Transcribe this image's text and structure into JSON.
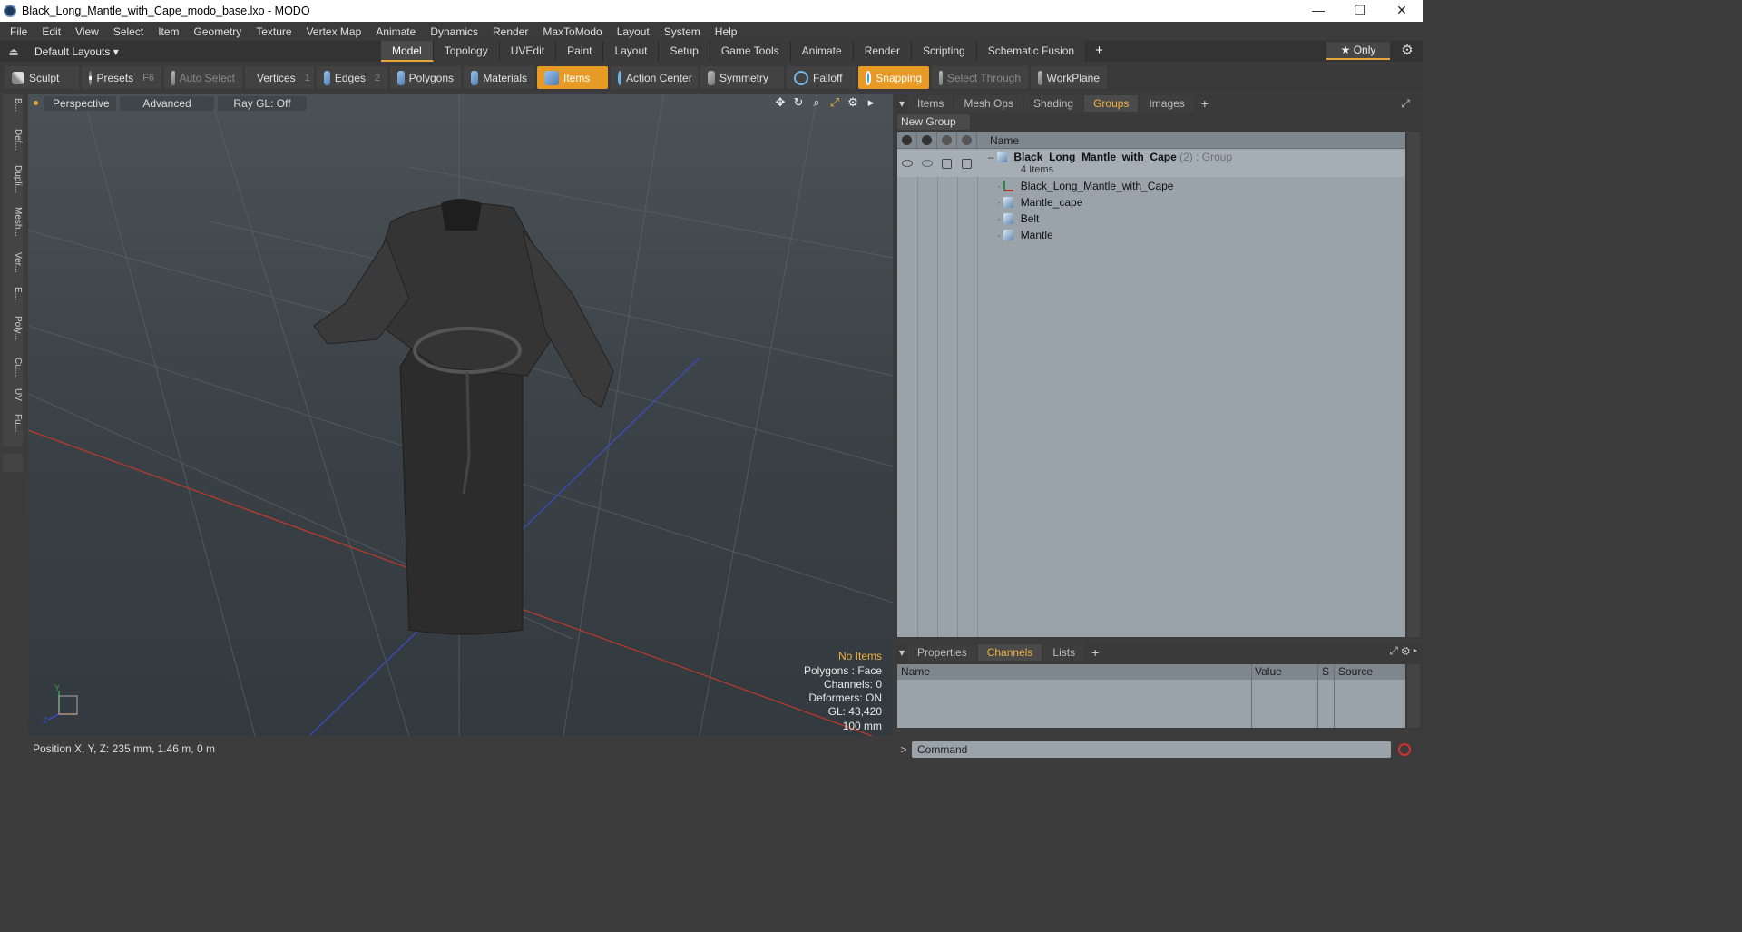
{
  "window": {
    "title": "Black_Long_Mantle_with_Cape_modo_base.lxo - MODO",
    "minimize": "—",
    "restore": "❐",
    "close": "✕"
  },
  "menu": [
    "File",
    "Edit",
    "View",
    "Select",
    "Item",
    "Geometry",
    "Texture",
    "Vertex Map",
    "Animate",
    "Dynamics",
    "Render",
    "MaxToModo",
    "Layout",
    "System",
    "Help"
  ],
  "layout_row": {
    "layouts": "Default Layouts ▾",
    "tabs": [
      "Model",
      "Topology",
      "UVEdit",
      "Paint",
      "Layout",
      "Setup",
      "Game Tools",
      "Animate",
      "Render",
      "Scripting",
      "Schematic Fusion"
    ],
    "active_tab": "Model",
    "add": "+",
    "only": "★  Only"
  },
  "toolbar": {
    "sculpt": "Sculpt",
    "presets": "Presets",
    "presets_key": "F6",
    "auto_select": "Auto Select",
    "vertices": "Vertices",
    "vertices_count": "1",
    "edges": "Edges",
    "edges_count": "2",
    "polygons": "Polygons",
    "materials": "Materials",
    "items": "Items",
    "action_center": "Action Center",
    "symmetry": "Symmetry",
    "falloff": "Falloff",
    "snapping": "Snapping",
    "select_through": "Select Through",
    "workplane": "WorkPlane"
  },
  "left_strip": [
    "B...",
    "Def...",
    "Dupli...",
    "Mesh...",
    "Ver...",
    "E...",
    "Poly...",
    "Cu...",
    "UV",
    "Fu..."
  ],
  "viewport": {
    "view": "Perspective",
    "advanced": "Advanced",
    "raygl": "Ray GL: Off",
    "info": {
      "selection": "No Items",
      "polygons": "Polygons : Face",
      "channels": "Channels: 0",
      "deformers": "Deformers: ON",
      "gl": "GL: 43,420",
      "scale": "100 mm"
    }
  },
  "status": {
    "position": "Position X, Y, Z:   235 mm, 1.46 m, 0 m"
  },
  "groups_panel": {
    "tabs": [
      "Items",
      "Mesh Ops",
      "Shading",
      "Groups",
      "Images"
    ],
    "active_tab": "Groups",
    "add": "+",
    "new_group": "New Group",
    "col_name": "Name",
    "group": {
      "name": "Black_Long_Mantle_with_Cape",
      "count": "(2)",
      "type": ": Group",
      "items_label": "4 Items"
    },
    "children": [
      "Black_Long_Mantle_with_Cape",
      "Mantle_cape",
      "Belt",
      "Mantle"
    ]
  },
  "channels_panel": {
    "tabs": [
      "Properties",
      "Channels",
      "Lists"
    ],
    "active_tab": "Channels",
    "add": "+",
    "columns": [
      "Name",
      "Value",
      "S",
      "Source"
    ]
  },
  "command": {
    "prompt": ">",
    "placeholder": "Command"
  },
  "colors": {
    "accent": "#e89a26",
    "active_tab_text": "#f0b040",
    "table_bg": "#9aa2aa",
    "x_axis": "#c0392b",
    "z_axis": "#3a4ec8"
  }
}
